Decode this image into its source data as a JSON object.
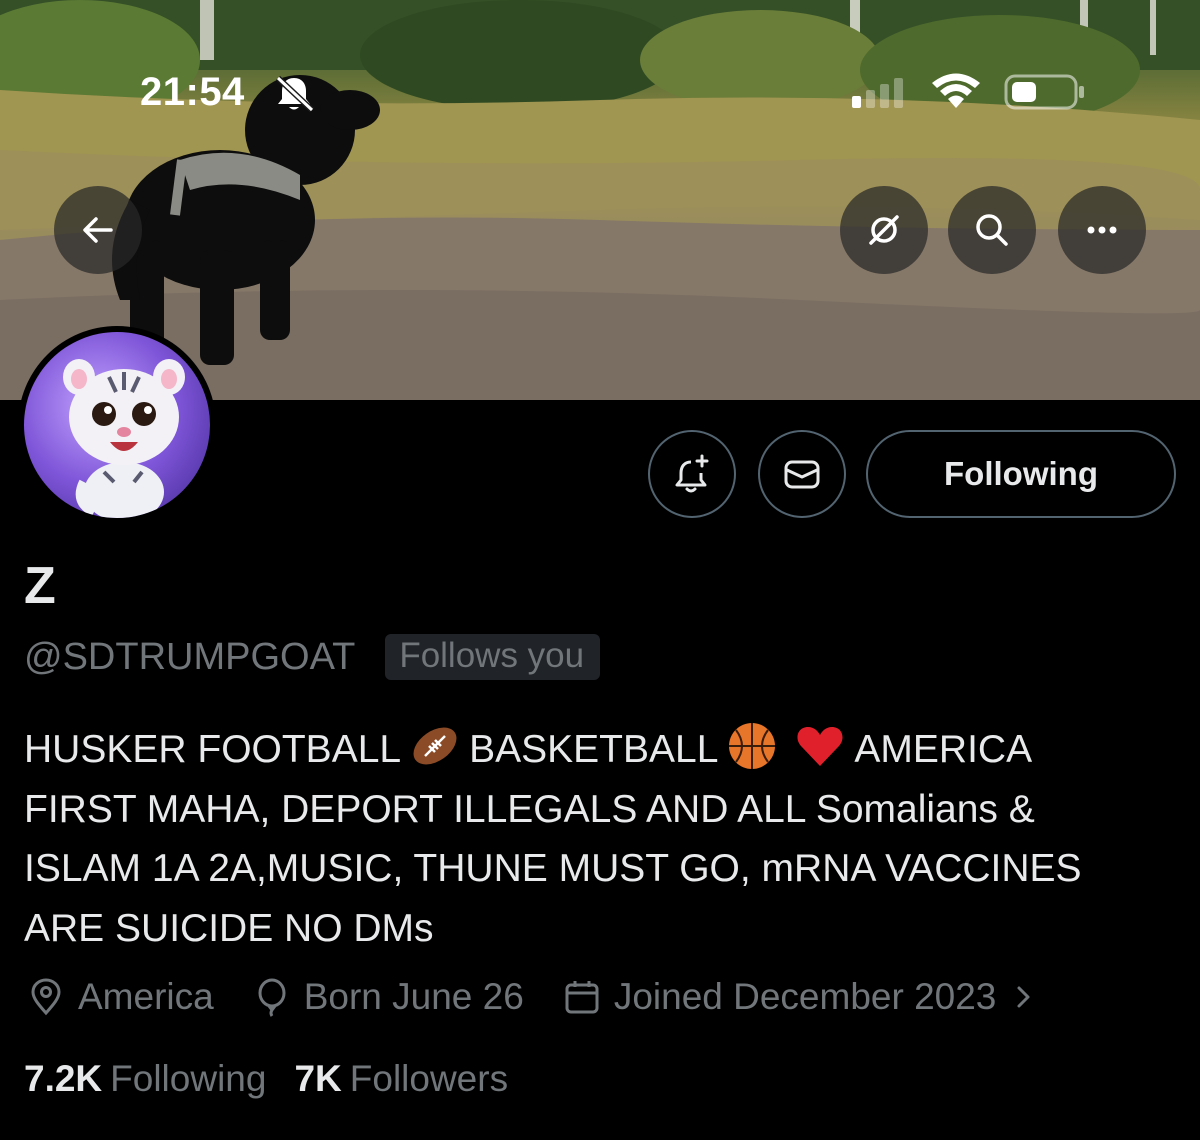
{
  "status_bar": {
    "time": "21:54",
    "bell_icon": "bell-slash-icon",
    "signal_icon": "cellular-signal-icon",
    "wifi_icon": "wifi-icon",
    "battery_icon": "battery-icon"
  },
  "header": {
    "back_icon": "arrow-left-icon",
    "grok_icon": "grok-icon",
    "search_icon": "search-icon",
    "more_icon": "more-horizontal-icon"
  },
  "actions": {
    "notify_icon": "bell-plus-icon",
    "message_icon": "envelope-icon",
    "following_label": "Following"
  },
  "profile": {
    "display_name": "Z",
    "handle": "@SDTRUMPGOAT",
    "follows_badge": "Follows you",
    "bio": {
      "line1_a": "HUSKER FOOTBALL",
      "line1_b": "BASKETBALL",
      "line1_c": "AMERICA",
      "line2": "FIRST MAHA, DEPORT ILLEGALS AND ALL Somalians &",
      "line3": "ISLAM 1A 2A,MUSIC, THUNE MUST GO, mRNA VACCINES",
      "line4": "ARE SUICIDE NO DMs"
    },
    "location": "America",
    "birthday": "Born June 26",
    "joined": "Joined December 2023"
  },
  "stats": {
    "following_count": "7.2K",
    "following_label": "Following",
    "followers_count": "7K",
    "followers_label": "Followers"
  },
  "colors": {
    "background": "#000000",
    "text": "#e7e9ea",
    "secondary_text": "#71767b",
    "border": "#536471",
    "badge_bg": "#202327"
  }
}
